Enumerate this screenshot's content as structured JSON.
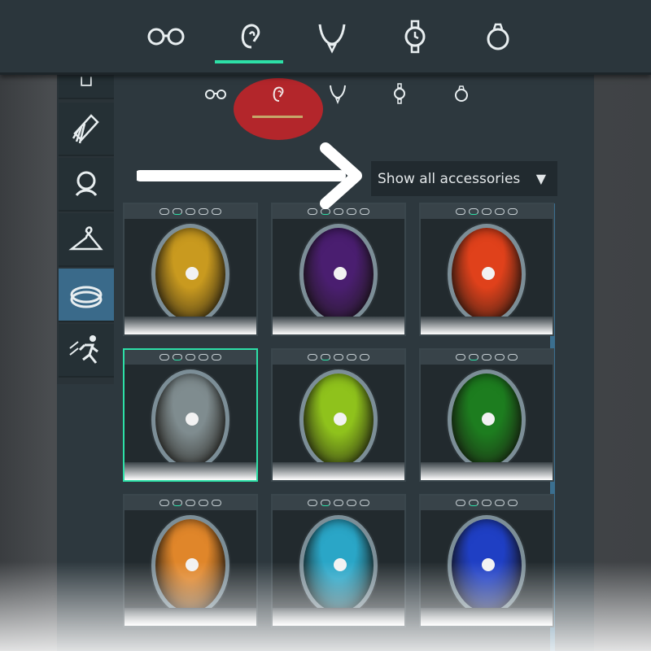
{
  "zoomed_tabs": [
    {
      "icon": "glasses-icon",
      "active": false
    },
    {
      "icon": "ear-icon",
      "active": true
    },
    {
      "icon": "necklace-icon",
      "active": false
    },
    {
      "icon": "watch-icon",
      "active": false
    },
    {
      "icon": "ring-icon",
      "active": false
    }
  ],
  "sidebar": {
    "items": [
      {
        "icon": "shirt-icon",
        "active": false
      },
      {
        "icon": "comb-icon",
        "active": false
      },
      {
        "icon": "head-icon",
        "active": false
      },
      {
        "icon": "hanger-icon",
        "active": false
      },
      {
        "icon": "accessory-ring-icon",
        "active": true
      },
      {
        "icon": "running-person-icon",
        "active": false
      }
    ]
  },
  "category_tabs": [
    {
      "icon": "glasses-icon"
    },
    {
      "icon": "ear-icon"
    },
    {
      "icon": "necklace-icon"
    },
    {
      "icon": "watch-icon"
    },
    {
      "icon": "ring-icon"
    }
  ],
  "filter": {
    "label": "Show all accessories",
    "caret": "▼"
  },
  "accent_color": "#2de0a7",
  "highlight_color": "#b3262b",
  "items": [
    {
      "tint": "#c99a1f",
      "selected": false
    },
    {
      "tint": "#4a1e70",
      "selected": false
    },
    {
      "tint": "#e0411b",
      "selected": false
    },
    {
      "tint": "#7f8c8f",
      "selected": true
    },
    {
      "tint": "#8fc21c",
      "selected": false
    },
    {
      "tint": "#1d7d1f",
      "selected": false
    },
    {
      "tint": "#e0862a",
      "selected": false
    },
    {
      "tint": "#2aa6c7",
      "selected": false
    },
    {
      "tint": "#1f3fc4",
      "selected": false
    }
  ]
}
